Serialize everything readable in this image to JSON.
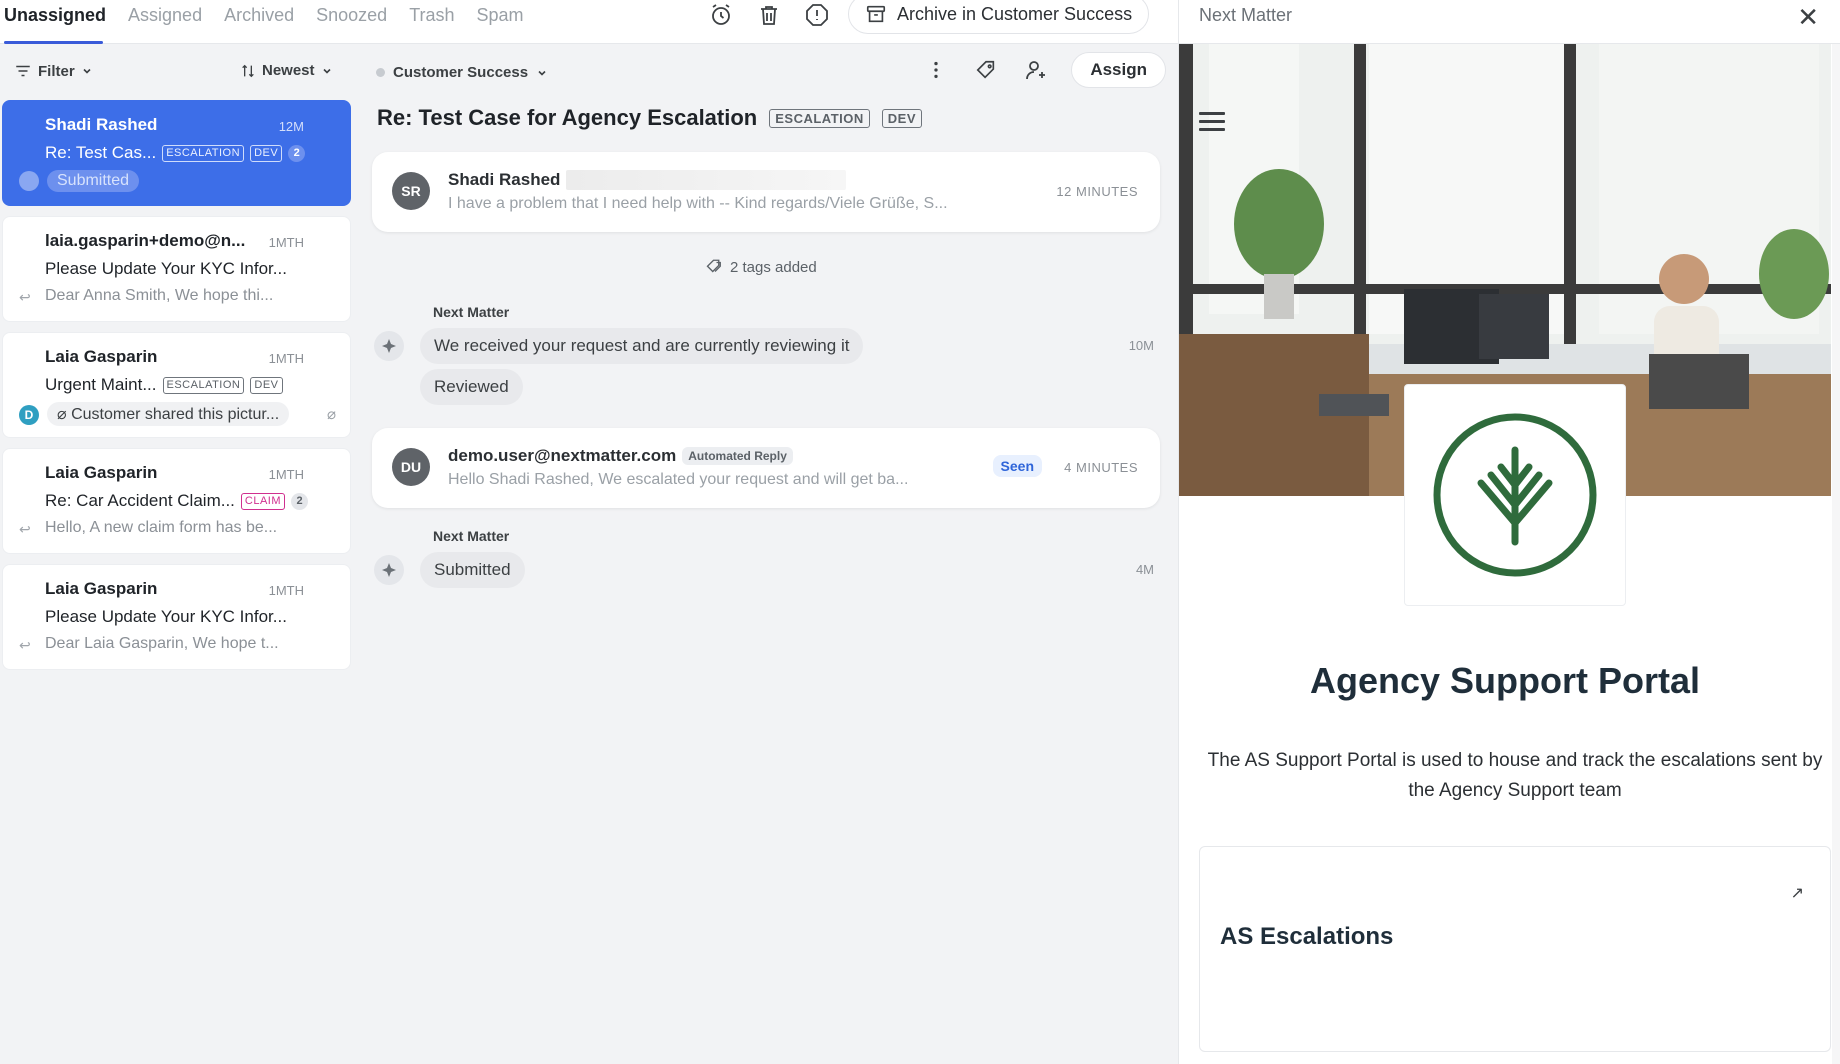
{
  "tabs": [
    "Unassigned",
    "Assigned",
    "Archived",
    "Snoozed",
    "Trash",
    "Spam"
  ],
  "topbar": {
    "archive_label": "Archive in Customer Success"
  },
  "list": {
    "filter_label": "Filter",
    "sort_label": "Newest",
    "cards": [
      {
        "from": "Shadi Rashed",
        "time": "12M",
        "subject": "Re: Test Cas...",
        "tags": [
          "ESCALATION",
          "DEV"
        ],
        "count": "2",
        "status": "Submitted"
      },
      {
        "from": "laia.gasparin+demo@n...",
        "time": "1MTH",
        "subject": "Please Update Your KYC Infor...",
        "preview": "Dear Anna Smith, We hope thi..."
      },
      {
        "from": "Laia Gasparin",
        "time": "1MTH",
        "subject": "Urgent Maint...",
        "tags": [
          "ESCALATION",
          "DEV"
        ],
        "avatar": "D",
        "shared": "Customer shared this pictur..."
      },
      {
        "from": "Laia Gasparin",
        "time": "1MTH",
        "subject": "Re: Car Accident Claim...",
        "tags": [
          "CLAIM"
        ],
        "count": "2",
        "preview": "Hello, A new claim form has be..."
      },
      {
        "from": "Laia Gasparin",
        "time": "1MTH",
        "subject": "Please Update Your KYC Infor...",
        "preview": "Dear Laia Gasparin, We hope t..."
      }
    ]
  },
  "conversation": {
    "team": "Customer Success",
    "assign_label": "Assign",
    "title": "Re: Test Case for Agency Escalation",
    "title_tags": [
      "ESCALATION",
      "DEV"
    ],
    "msg1": {
      "initials": "SR",
      "sender": "Shadi Rashed",
      "snippet": "I have a problem that I need help with -- Kind regards/Viele Grüße, S...",
      "time": "12 MINUTES"
    },
    "tags_added": "2 tags added",
    "event1": {
      "label": "Next Matter",
      "text": "We received your request and are currently reviewing it",
      "status": "Reviewed",
      "time": "10M"
    },
    "msg2": {
      "initials": "DU",
      "sender": "demo.user@nextmatter.com",
      "badge": "Automated Reply",
      "snippet": "Hello Shadi Rashed, We escalated your request and will get ba...",
      "seen": "Seen",
      "time": "4 MINUTES"
    },
    "event2": {
      "label": "Next Matter",
      "status": "Submitted",
      "time": "4M"
    }
  },
  "right_panel": {
    "title": "Next Matter",
    "portal_title": "Agency Support Portal",
    "portal_desc": "The AS Support Portal is used to house and track the escalations sent by the Agency Support team",
    "card_title": "AS Escalations"
  },
  "colors": {
    "accent": "#3d6ee8",
    "claim": "#d02f8f",
    "logo_green": "#2f6b3c"
  }
}
